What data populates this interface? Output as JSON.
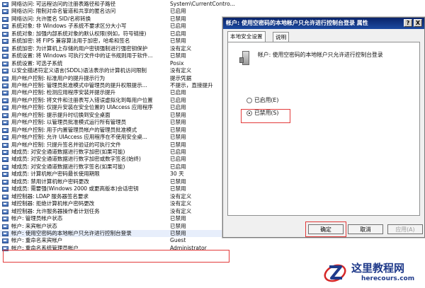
{
  "policies": [
    {
      "name": "网络访问: 可远程访问的注册表路径和子路径",
      "value": "System\\CurrentContro..."
    },
    {
      "name": "网络访问: 限制对命名管道和共享的匿名访问",
      "value": "已启用"
    },
    {
      "name": "网络访问: 允许匿名 SID/名称转换",
      "value": "已禁用"
    },
    {
      "name": "系统对象: 非 Windows 子系统不要求区分大小写",
      "value": "已启用"
    },
    {
      "name": "系统对象: 加强内部系统对象的默认权限(例如，符号链接)",
      "value": "已启用"
    },
    {
      "name": "系统加密: 将 FIPS 兼容算法用于加密，哈希和签名",
      "value": "已禁用"
    },
    {
      "name": "系统加密: 为计算机上存储的用户密钥强制进行强密钥保护",
      "value": "没有定义"
    },
    {
      "name": "系统设置: 将 Windows 可执行文件中的证书规则用于软件...",
      "value": "已禁用"
    },
    {
      "name": "系统设置: 可选子系统",
      "value": "Posix"
    },
    {
      "name": "以安全描述符定义语言(SDDL)语法表示的计算机访问限制",
      "value": "没有定义"
    },
    {
      "name": "用户帐户控制: 标准用户的提升提示行为",
      "value": "提示凭据"
    },
    {
      "name": "用户帐户控制: 管理员批准模式中管理员的提升权限提示...",
      "value": "不提示，直接提升"
    },
    {
      "name": "用户帐户控制: 检测应用程序安装并提示提升",
      "value": "已启用"
    },
    {
      "name": "用户帐户控制: 将文件和注册表写入错误虚拟化到每用户位置",
      "value": "已启用"
    },
    {
      "name": "用户帐户控制: 仅提升安装在安全位置的 UIAccess 应用程序",
      "value": "已启用"
    },
    {
      "name": "用户帐户控制: 提示提升时切换到安全桌面",
      "value": "已禁用"
    },
    {
      "name": "用户帐户控制: 以管理员批准模式运行所有管理员",
      "value": "已禁用"
    },
    {
      "name": "用户帐户控制: 用于内置管理员帐户的管理员批准模式",
      "value": "已禁用"
    },
    {
      "name": "用户帐户控制: 允许 UIAccess 应用程序在不使用安全桌...",
      "value": "已禁用"
    },
    {
      "name": "用户帐户控制: 只提升签名并验证的可执行文件",
      "value": "已禁用"
    },
    {
      "name": "域成员: 对安全通道数据进行数字加密(如果可能)",
      "value": "已启用"
    },
    {
      "name": "域成员: 对安全通道数据进行数字加密或数字签名(始终)",
      "value": "已启用"
    },
    {
      "name": "域成员: 对安全通道数据进行数字签名(如果可能)",
      "value": "已启用"
    },
    {
      "name": "域成员: 计算机帐户密码最长使用期限",
      "value": "30 天"
    },
    {
      "name": "域成员: 禁用计算机帐户密码更改",
      "value": "已禁用"
    },
    {
      "name": "域成员: 需要强(Windows 2000 或更高版本)会话密钥",
      "value": "已禁用"
    },
    {
      "name": "域控制器: LDAP 服务器签名要求",
      "value": "没有定义"
    },
    {
      "name": "域控制器: 拒绝计算机帐户密码更改",
      "value": "没有定义"
    },
    {
      "name": "域控制器: 允许服务器操作者计划任务",
      "value": "没有定义"
    },
    {
      "name": "帐户: 管理员帐户状态",
      "value": "已禁用"
    },
    {
      "name": "帐户: 来宾帐户状态",
      "value": "已禁用"
    },
    {
      "name": "帐户: 使用空密码的本地帐户只允许进行控制台登录",
      "value": "已禁用"
    },
    {
      "name": "帐户: 重命名来宾帐户",
      "value": "Guest"
    },
    {
      "name": "帐户: 重命名系统管理员帐户",
      "value": "Administrator"
    }
  ],
  "highlighted_index": 31,
  "dialog": {
    "title": "帐户: 使用空密码的本地帐户只允许进行控制台登录 属性",
    "help_btn": "?",
    "close_btn": "X",
    "tabs": [
      "本地安全设置",
      "说明"
    ],
    "policy_title": "帐户: 使用空密码的本地帐户只允许进行控制台登录",
    "option_enabled": "已启用(E)",
    "option_disabled": "已禁用(S)",
    "selected": "disabled",
    "ok": "确定",
    "cancel": "取消",
    "apply": "应用(A)"
  },
  "watermark": {
    "title": "这里教程网",
    "url": "herecours.com"
  },
  "colors": {
    "highlight_border": "#e23b3b",
    "titlebar": "#0a246a",
    "brand": "#1f3a8a"
  }
}
